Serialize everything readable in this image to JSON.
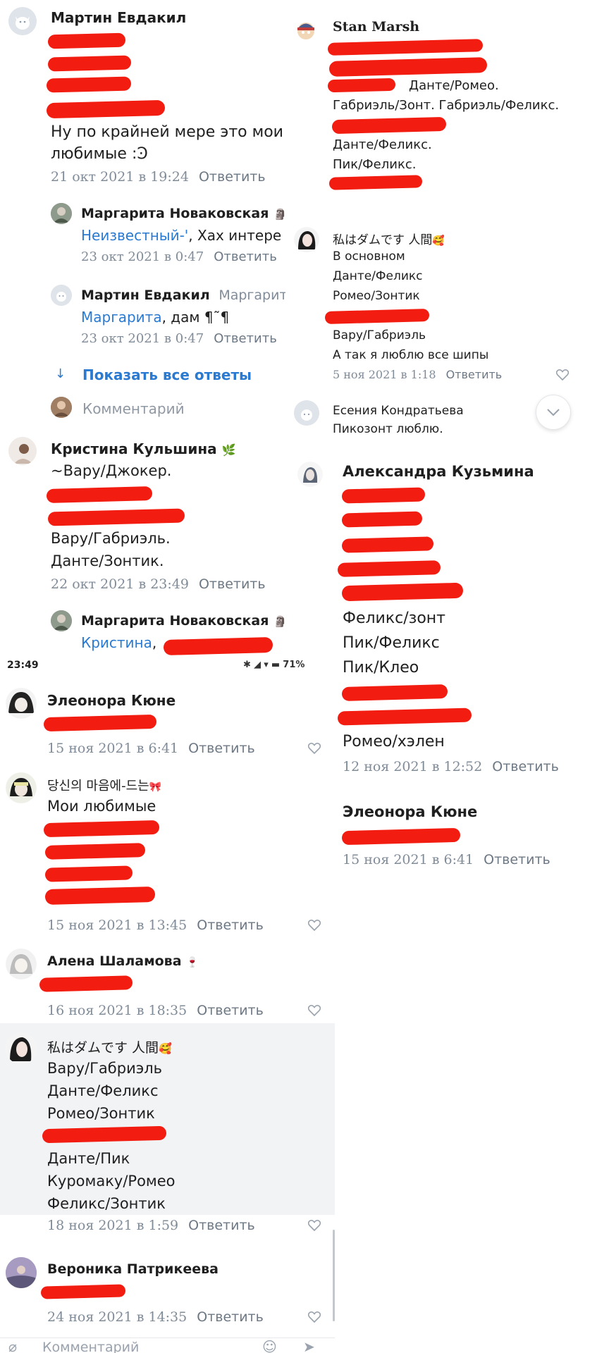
{
  "panel_a": {
    "c1": {
      "author": "Мартин Евдакил",
      "lines": [
        "Ну по крайней мере это мои",
        "любимые :Ͽ"
      ],
      "date": "21 окт 2021 в 19:24",
      "reply": "Ответить"
    },
    "r1": {
      "author": "Маргарита Новаковская",
      "badge": "🗿",
      "mention": "Неизвестный-'",
      "text": ", Хах интере",
      "date": "23 окт 2021 в 0:47",
      "reply": "Ответить"
    },
    "r2": {
      "author": "Мартин Евдакил",
      "author2": "Маргарите",
      "mention": "Маргарита",
      "text": ", дам ¶˜¶",
      "date": "23 окт 2021 в 0:47",
      "reply": "Ответить"
    },
    "show_all": "Показать все ответы",
    "comment_placeholder": "Комментарий",
    "c2": {
      "author": "Кристина Кульшина",
      "badge": "🌿",
      "lines": [
        "~Вару/Джокер.",
        "Вару/Габриэль.",
        "Данте/Зонтик."
      ],
      "date": "22 окт 2021 в 23:49",
      "reply": "Ответить"
    },
    "r3": {
      "author": "Маргарита Новаковская",
      "badge": "🗿",
      "mention": "Кристина"
    }
  },
  "panel_b": {
    "c1": {
      "author": "Stan Marsh",
      "line_a": "Данте/Ромео.",
      "line_b": "Габриэль/Зонт. Габриэль/Феликс.",
      "line_c": "Данте/Феликс.",
      "line_d": "Пик/Феликс."
    },
    "c2": {
      "author": "私はダムです 人間",
      "badge": "🥰",
      "lines": [
        "В основном",
        "Данте/Феликс",
        "Ромео/Зонтик",
        "Вару/Габриэль",
        "А так я люблю все шипы"
      ],
      "date": "5 ноя 2021 в 1:18",
      "reply": "Ответить"
    },
    "c3": {
      "author": "Есения Кондратьева",
      "line": "Пикозонт люблю."
    }
  },
  "panel_c": {
    "c1": {
      "author": "Александра Кузьмина",
      "lines": [
        "Феликс/зонт",
        "Пик/Феликс",
        "Пик/Клео",
        "Ромео/хэлен"
      ],
      "date": "12 ноя 2021 в 12:52",
      "reply": "Ответить"
    },
    "c2": {
      "author": "Элеонора Кюне",
      "date": "15 ноя 2021 в 6:41",
      "reply": "Ответить"
    }
  },
  "status_bar": {
    "time": "23:49",
    "battery": "71%"
  },
  "panel_d": {
    "c1": {
      "author": "Элеонора Кюне",
      "date": "15 ноя 2021 в 6:41",
      "reply": "Ответить"
    },
    "c2": {
      "author": "당신의 마음에-드는",
      "badge": "🎀",
      "lines": [
        "Мои любимые"
      ],
      "date": "15 ноя 2021 в 13:45",
      "reply": "Ответить"
    },
    "c3": {
      "author": "Алена Шаламова",
      "badge": "🍷",
      "date": "16 ноя 2021 в 18:35",
      "reply": "Ответить"
    },
    "c4": {
      "author": "私はダムです 人間",
      "badge": "🥰",
      "lines": [
        "Вару/Габриэль",
        "Данте/Феликс",
        "Ромео/Зонтик",
        "Данте/Пик",
        "Куромаку/Ромео",
        "Феликс/Зонтик"
      ],
      "date": "18 ноя 2021 в 1:59",
      "reply": "Ответить"
    },
    "c5": {
      "author": "Вероника Патрикеева",
      "date": "24 ноя 2021 в 14:35",
      "reply": "Ответить"
    },
    "comment_placeholder": "Комментарий"
  },
  "colors": {
    "accent": "#2a7ad1",
    "scribble": "#f21c10",
    "muted": "#818c99"
  }
}
